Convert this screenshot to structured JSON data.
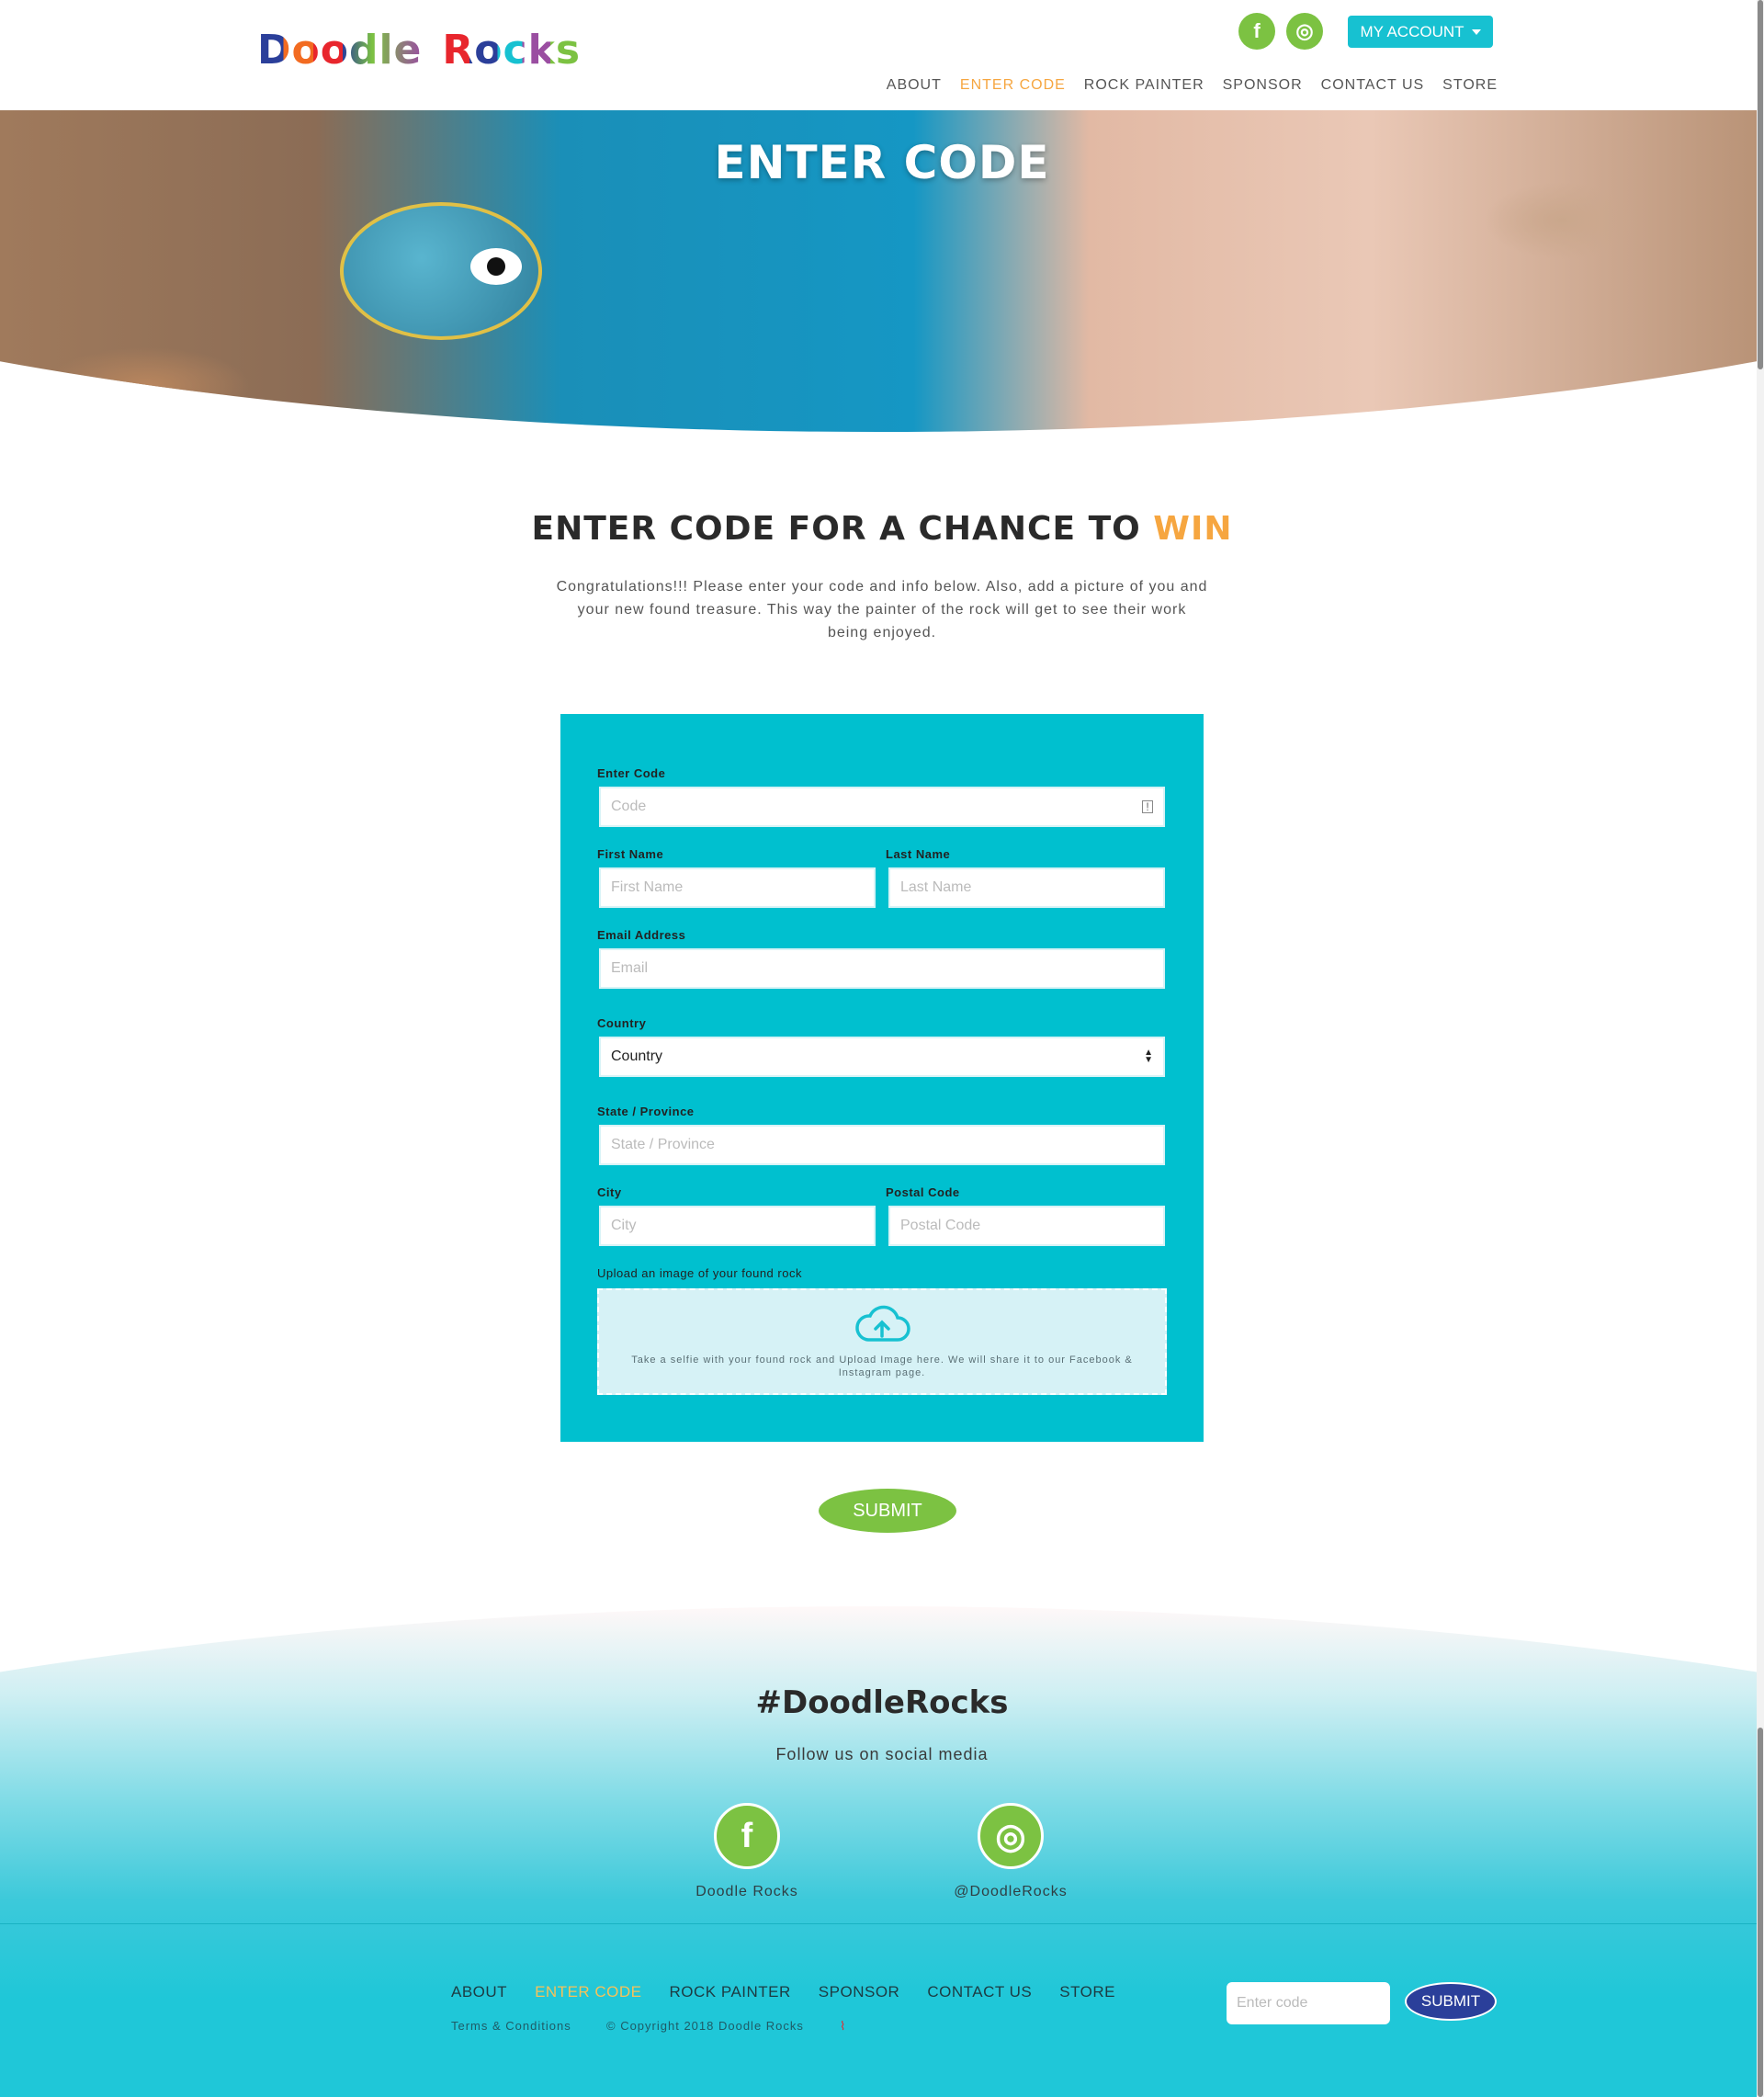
{
  "header": {
    "logo_word1": "Doodle",
    "logo_word2": "Rocks",
    "social": [
      {
        "icon": "facebook-icon",
        "glyph": "f"
      },
      {
        "icon": "instagram-icon",
        "glyph": "◎"
      }
    ],
    "account_label": "MY ACCOUNT",
    "nav": [
      "ABOUT",
      "ENTER CODE",
      "ROCK PAINTER",
      "SPONSOR",
      "CONTACT US",
      "STORE"
    ],
    "active_nav": "ENTER CODE"
  },
  "hero": {
    "title": "ENTER CODE"
  },
  "intro": {
    "title_prefix": "ENTER CODE FOR A CHANCE TO",
    "title_highlight": "WIN",
    "text": "Congratulations!!! Please enter your code and info below. Also, add a picture of you and your new found treasure. This way the painter of the rock will get to see their work being enjoyed."
  },
  "form": {
    "code_label": "Enter Code",
    "code_placeholder": "Code",
    "first_name_label": "First Name",
    "first_name_placeholder": "First Name",
    "last_name_label": "Last Name",
    "last_name_placeholder": "Last Name",
    "email_label": "Email Address",
    "email_placeholder": "Email",
    "country_label": "Country",
    "country_value": "Country",
    "state_label": "State / Province",
    "state_placeholder": "State / Province",
    "city_label": "City",
    "city_placeholder": "City",
    "postal_label": "Postal Code",
    "postal_placeholder": "Postal Code",
    "upload_label": "Upload an image of your found rock",
    "upload_text": "Take a selfie with your found rock and Upload Image here. We will share it to our Facebook & Instagram page.",
    "submit_label": "SUBMIT"
  },
  "footer": {
    "hashtag": "#DoodleRocks",
    "follow": "Follow us on social media",
    "facebook_label": "Doodle Rocks",
    "instagram_label": "@DoodleRocks",
    "nav": [
      "ABOUT",
      "ENTER CODE",
      "ROCK PAINTER",
      "SPONSOR",
      "CONTACT US",
      "STORE"
    ],
    "active_nav": "ENTER CODE",
    "terms": "Terms & Conditions",
    "copyright": "© Copyright 2018 Doodle Rocks",
    "code_placeholder": "Enter code",
    "submit_label": "SUBMIT"
  },
  "colors": {
    "accent": "#17c1d1",
    "brand_green": "#7cc242",
    "highlight": "#f6a640",
    "dark_blue": "#2b3f9a"
  }
}
